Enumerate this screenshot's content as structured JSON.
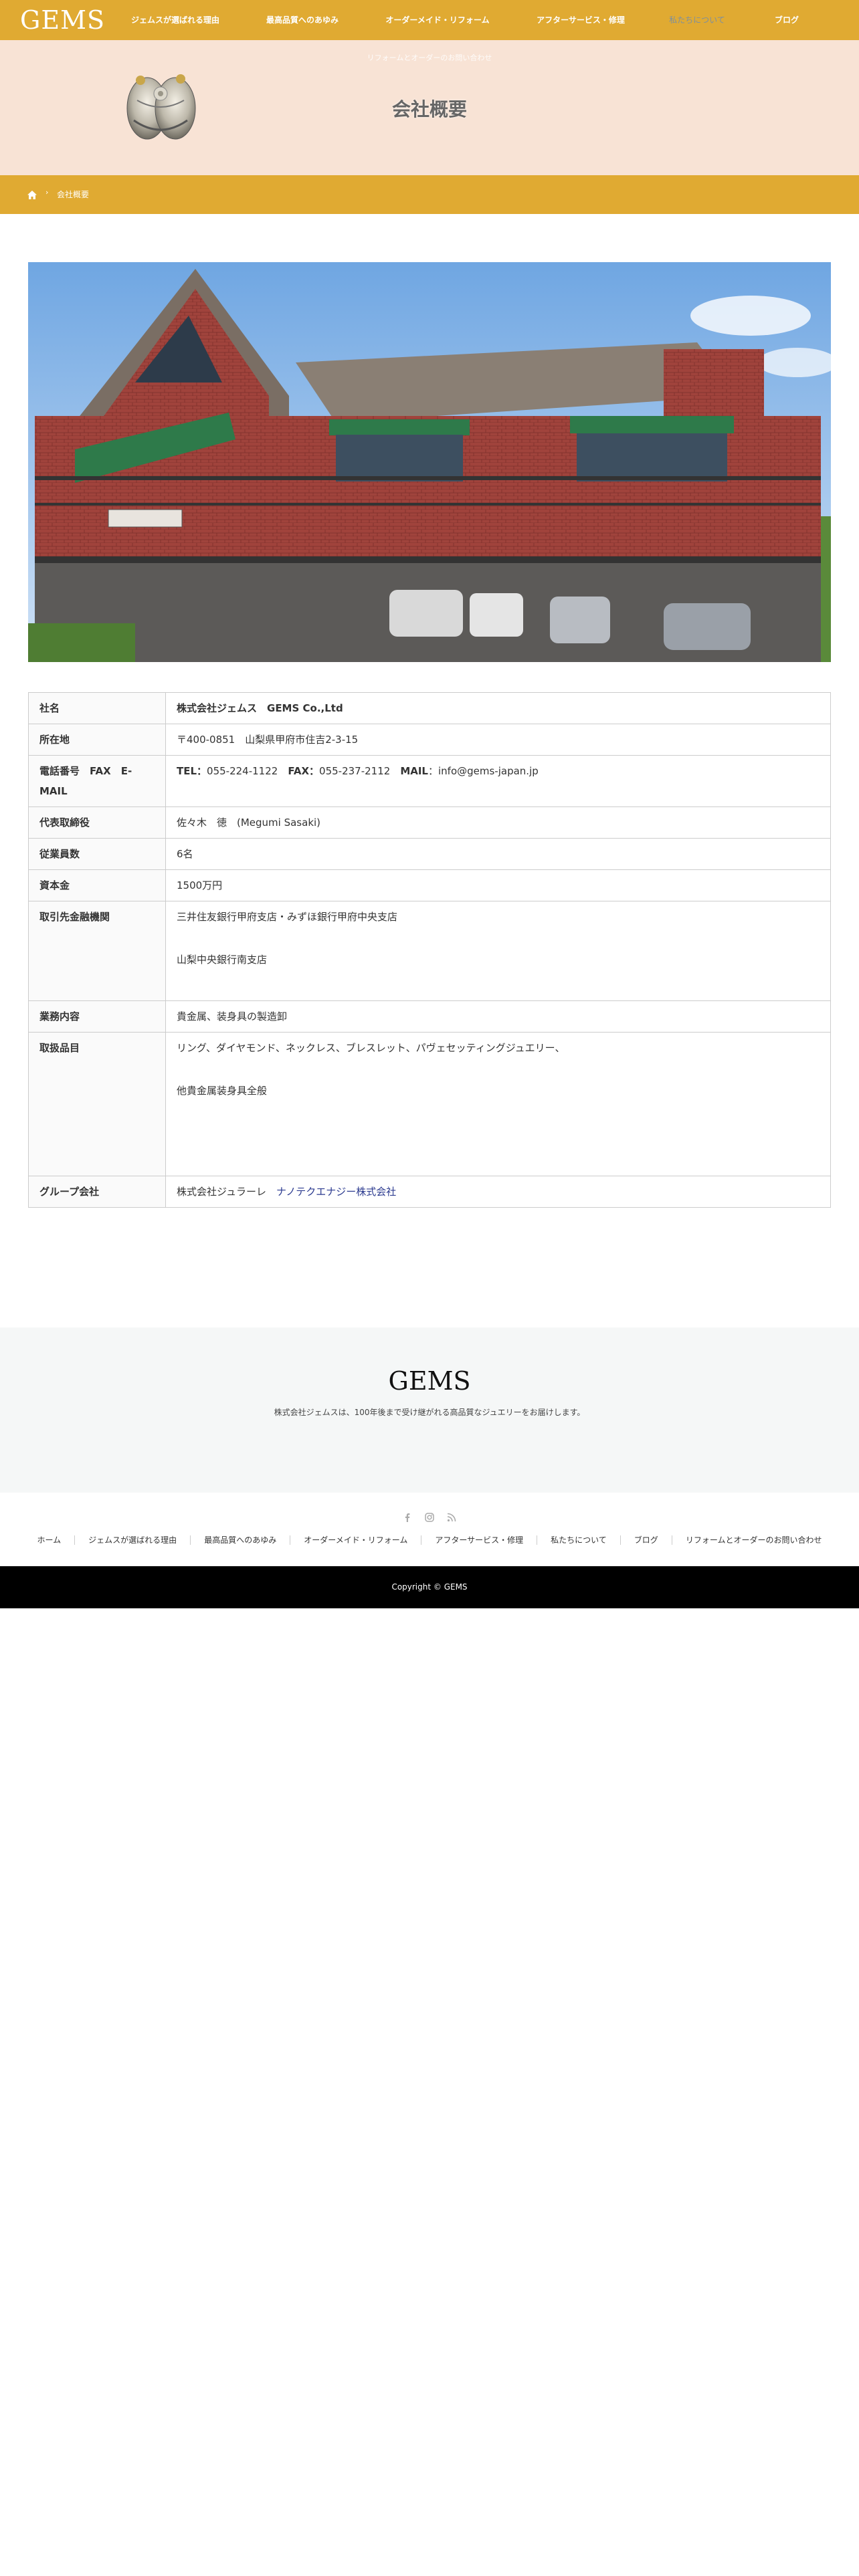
{
  "header": {
    "logo": "GEMS",
    "nav": [
      {
        "label": "ジェムスが選ばれる理由"
      },
      {
        "label": "最高品質へのあゆみ"
      },
      {
        "label": "オーダーメイド・リフォーム"
      },
      {
        "label": "アフターサービス・修理"
      },
      {
        "label": "私たちについて"
      },
      {
        "label": "ブログ"
      }
    ],
    "active_index": 4
  },
  "hero": {
    "tagline": "リフォームとオーダーのお問い合わせ",
    "title": "会社概要"
  },
  "breadcrumb": {
    "home_icon": "home-icon",
    "separator": "›",
    "current": "会社概要"
  },
  "company": {
    "rows": [
      {
        "label": "社名",
        "value": "株式会社ジェムス　GEMS Co.,Ltd"
      },
      {
        "label": "所在地",
        "value": "〒400-0851　山梨県甲府市住吉2-3-15"
      },
      {
        "label": "電話番号　FAX　E-MAIL",
        "tel_label": "TEL：",
        "tel": "055-224-1122",
        "fax_label": "FAX：",
        "fax": "055-237-2112",
        "mail_label": "MAIL",
        "mail": "：info@gems-japan.jp"
      },
      {
        "label": "代表取締役",
        "value": "佐々木　徳　(Megumi Sasaki)"
      },
      {
        "label": "従業員数",
        "value": "6名"
      },
      {
        "label": "資本金",
        "value": "1500万円"
      },
      {
        "label": "取引先金融機関",
        "line1": "三井住友銀行甲府支店・みずほ銀行甲府中央支店",
        "line2": "山梨中央銀行南支店"
      },
      {
        "label": "業務内容",
        "value": "貴金属、装身具の製造卸"
      },
      {
        "label": "取扱品目",
        "line1": "リング、ダイヤモンド、ネックレス、ブレスレット、パヴェセッティングジュエリー、",
        "line2": "他貴金属装身具全般"
      },
      {
        "label": "グループ会社",
        "value_plain": "株式会社ジュラーレ　",
        "value_link": "ナノテクエナジー株式会社"
      }
    ]
  },
  "footer": {
    "logo": "GEMS",
    "description": "株式会社ジェムスは、100年後まで受け継がれる高品質なジュエリーをお届けします。",
    "social": [
      "facebook-icon",
      "instagram-icon",
      "rss-icon"
    ],
    "nav": [
      {
        "label": "ホーム"
      },
      {
        "label": "ジェムスが選ばれる理由"
      },
      {
        "label": "最高品質へのあゆみ"
      },
      {
        "label": "オーダーメイド・リフォーム"
      },
      {
        "label": "アフターサービス・修理"
      },
      {
        "label": "私たちについて"
      },
      {
        "label": "ブログ"
      },
      {
        "label": "リフォームとオーダーのお問い合わせ"
      }
    ],
    "copyright": "Copyright ©  GEMS"
  },
  "colors": {
    "accent": "#e0aa32",
    "hero_bg": "#f8e3d5",
    "footer_bg": "#f5f7f7",
    "nav_active": "#7c8fa0"
  }
}
